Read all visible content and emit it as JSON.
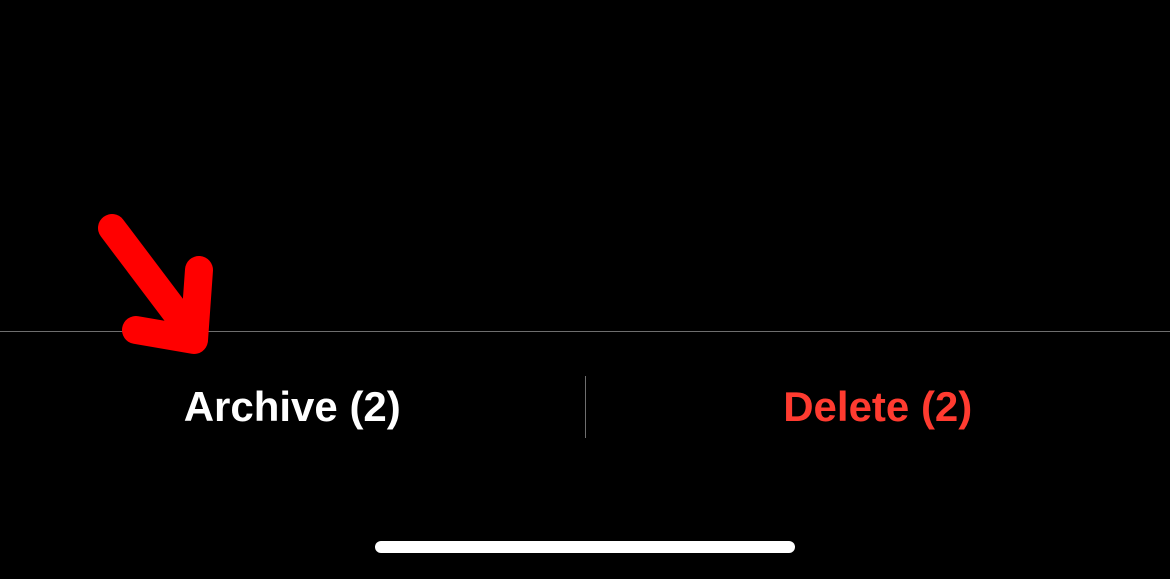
{
  "toolbar": {
    "archive_label": "Archive (2)",
    "delete_label": "Delete (2)"
  },
  "colors": {
    "destructive": "#ff3b30",
    "primary_text": "#ffffff",
    "annotation": "#ff0000"
  }
}
